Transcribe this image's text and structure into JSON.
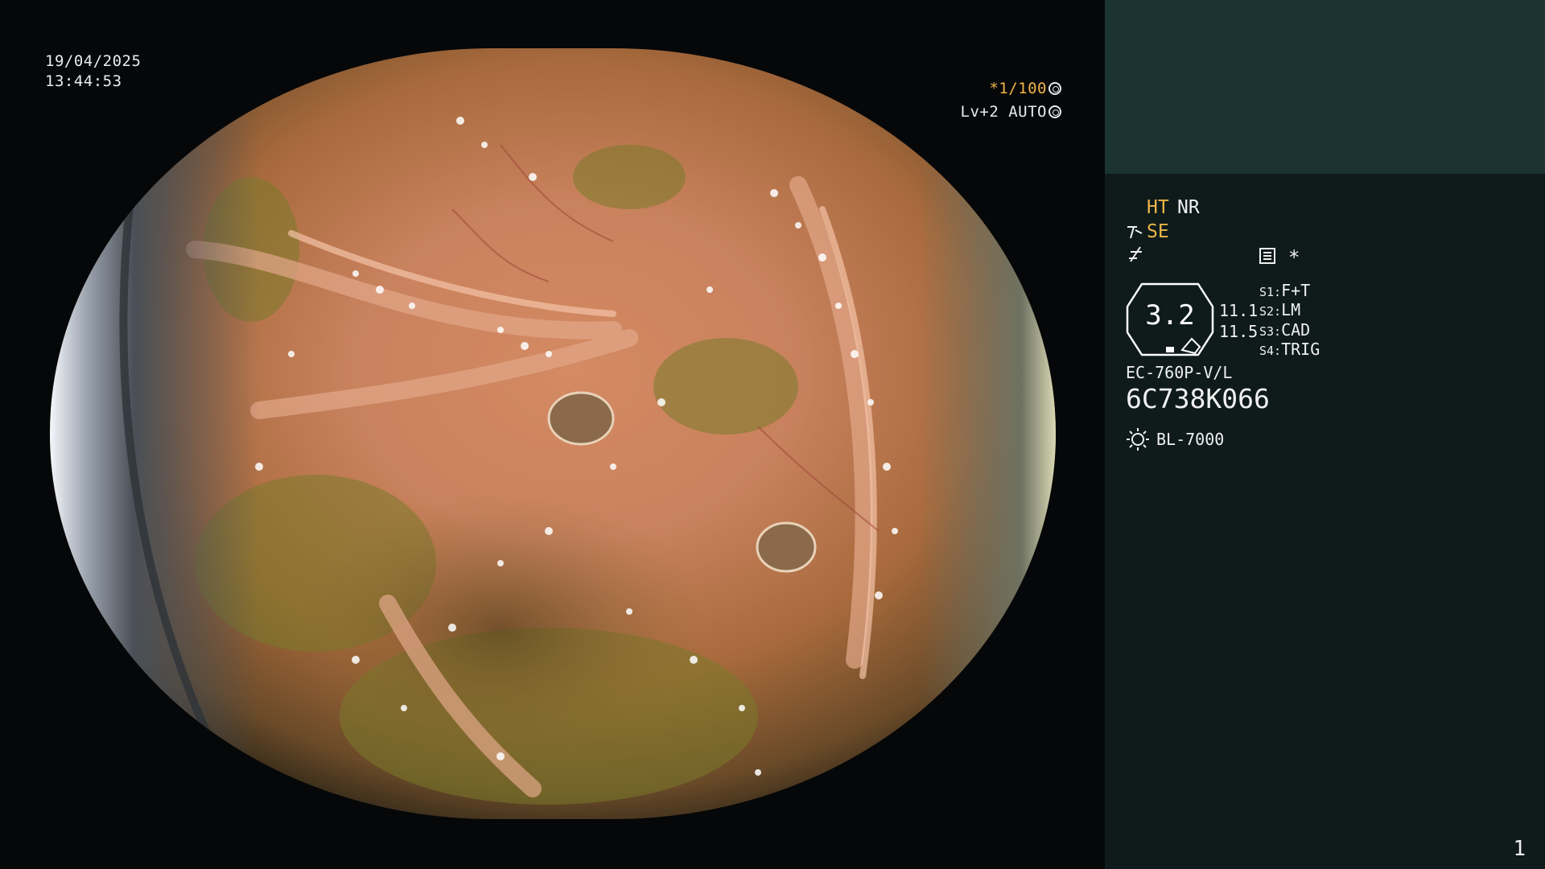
{
  "video": {
    "date": "19/04/2025",
    "time": "13:44:53",
    "shutter_prefix": "*",
    "shutter_value": "1/100",
    "shutter_icon": "aperture-icon",
    "level": "Lv+2",
    "exposure_mode": "AUTO",
    "exposure_icon": "iris-icon"
  },
  "panel": {
    "modes": {
      "ht": "HT",
      "nr": "NR",
      "se": "SE"
    },
    "icons": {
      "se": "scope-tip-icon",
      "filter": "filter-icon",
      "menu": "menu-icon"
    },
    "star": "*",
    "zoom": {
      "value": "3.2",
      "upper": "11.1",
      "lower": "11.5"
    },
    "switches": [
      {
        "key": "S1:",
        "value": "F+T"
      },
      {
        "key": "S2:",
        "value": "LM"
      },
      {
        "key": "S3:",
        "value": "CAD"
      },
      {
        "key": "S4:",
        "value": "TRIG"
      }
    ],
    "scope_model": "EC-760P-V/L",
    "scope_serial": "6C738K066",
    "light_source": "BL-7000",
    "page": "1"
  },
  "colors": {
    "accent_amber": "#f0b54a",
    "panel_top": "#1b3331",
    "panel_body": "#0e1b1a"
  }
}
